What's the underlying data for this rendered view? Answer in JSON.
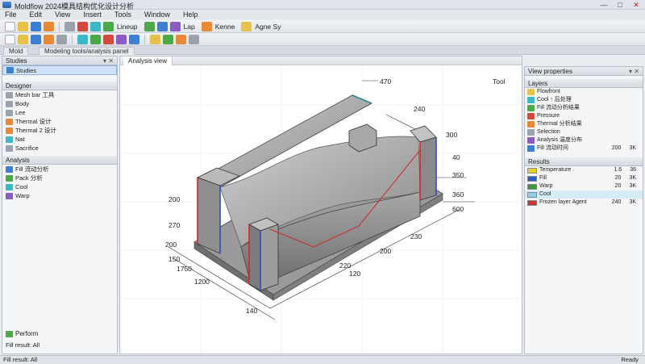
{
  "window": {
    "title": "Moldflow 2024模具结构优化设计分析"
  },
  "menu": [
    "File",
    "Edit",
    "View",
    "Insert",
    "Tools",
    "Window",
    "Help"
  ],
  "toolbar1": {
    "label1": "Lineup",
    "label2": "Lap",
    "label3": "Kenne",
    "label4": "Agne Sy"
  },
  "tabs": {
    "tab1": "Mold",
    "tab2": "Modeling tools/analysis panel"
  },
  "left_panel": {
    "header": "Studies",
    "top_header": "Designer",
    "items": [
      "Mesh bar 工具",
      "Body",
      "Lee",
      "Thermal 设计",
      "Thermal 2 设计",
      "Nat",
      "Sacrifice"
    ],
    "header2": "Analysis",
    "items2": [
      "Fill 流动分析",
      "Pack 分析",
      "Cool",
      "Warp"
    ],
    "footer": "Perform",
    "status": "Fill result: All"
  },
  "viewport": {
    "tab": "Analysis view",
    "corner_label": "Tool",
    "dims": [
      "470",
      "240",
      "300",
      "200",
      "40",
      "350",
      "360",
      "600",
      "270",
      "200",
      "150",
      "230",
      "200",
      "1200",
      "220",
      "140",
      "120",
      "1750"
    ]
  },
  "right_panel": {
    "header": "View properties",
    "layers_header": "Layers",
    "layer_items": [
      "Flowfront",
      "Cool ↑ 后处理",
      "Fill 流动分析结果",
      "Pressure",
      "Thermal 分析结果",
      "Selection",
      "Analysis 温度分布",
      "Fill 流动时间"
    ],
    "layer_values": [
      [
        "200",
        "3K"
      ]
    ],
    "results_header": "Results",
    "results": [
      {
        "label": "Temperature",
        "v1": "1.6",
        "v2": "36",
        "color": "#e8d22a"
      },
      {
        "label": "Fill",
        "v1": "20",
        "v2": "3K",
        "color": "#2a5cc8"
      },
      {
        "label": "Warp",
        "v1": "20",
        "v2": "3K",
        "color": "#3a9a3a"
      },
      {
        "label": "Cool",
        "v1": "",
        "v2": "",
        "color": "#8fd0e8"
      },
      {
        "label": "Frozen layer Agent",
        "v1": "240",
        "v2": "3K",
        "color": "#cc3333"
      }
    ]
  },
  "status": {
    "right": "Ready"
  },
  "colors": {
    "part": "#8e8e8e",
    "accent_red": "#cc2a2a",
    "accent_blue": "#2a4fb8"
  }
}
